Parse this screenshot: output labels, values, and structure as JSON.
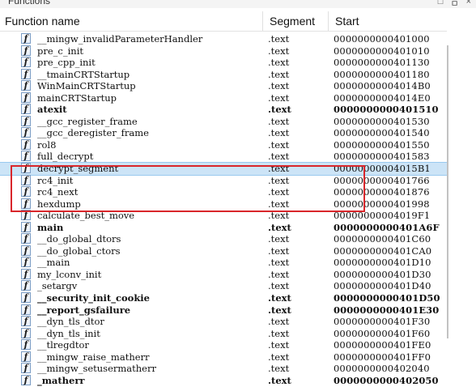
{
  "window": {
    "title": "Functions",
    "controls": [
      "□",
      "ㅁ",
      "×"
    ]
  },
  "columns": {
    "name": "Function name",
    "segment": "Segment",
    "start": "Start"
  },
  "functions": [
    {
      "name": "__mingw_invalidParameterHandler",
      "segment": ".text",
      "start": "0000000000401000",
      "bold": false
    },
    {
      "name": "pre_c_init",
      "segment": ".text",
      "start": "0000000000401010",
      "bold": false
    },
    {
      "name": "pre_cpp_init",
      "segment": ".text",
      "start": "0000000000401130",
      "bold": false
    },
    {
      "name": "__tmainCRTStartup",
      "segment": ".text",
      "start": "0000000000401180",
      "bold": false
    },
    {
      "name": "WinMainCRTStartup",
      "segment": ".text",
      "start": "00000000004014B0",
      "bold": false
    },
    {
      "name": "mainCRTStartup",
      "segment": ".text",
      "start": "00000000004014E0",
      "bold": false
    },
    {
      "name": "atexit",
      "segment": ".text",
      "start": "0000000000401510",
      "bold": true
    },
    {
      "name": "__gcc_register_frame",
      "segment": ".text",
      "start": "0000000000401530",
      "bold": false
    },
    {
      "name": "__gcc_deregister_frame",
      "segment": ".text",
      "start": "0000000000401540",
      "bold": false
    },
    {
      "name": "rol8",
      "segment": ".text",
      "start": "0000000000401550",
      "bold": false
    },
    {
      "name": "full_decrypt",
      "segment": ".text",
      "start": "0000000000401583",
      "bold": false
    },
    {
      "name": "decrypt_segment",
      "segment": ".text",
      "start": "00000000004015B1",
      "bold": false,
      "selected": true
    },
    {
      "name": "rc4_init",
      "segment": ".text",
      "start": "0000000000401766",
      "bold": false
    },
    {
      "name": "rc4_next",
      "segment": ".text",
      "start": "0000000000401876",
      "bold": false
    },
    {
      "name": "hexdump",
      "segment": ".text",
      "start": "0000000000401998",
      "bold": false
    },
    {
      "name": "calculate_best_move",
      "segment": ".text",
      "start": "00000000004019F1",
      "bold": false
    },
    {
      "name": "main",
      "segment": ".text",
      "start": "0000000000401A6F",
      "bold": true
    },
    {
      "name": "__do_global_dtors",
      "segment": ".text",
      "start": "0000000000401C60",
      "bold": false
    },
    {
      "name": "__do_global_ctors",
      "segment": ".text",
      "start": "0000000000401CA0",
      "bold": false
    },
    {
      "name": "__main",
      "segment": ".text",
      "start": "0000000000401D10",
      "bold": false
    },
    {
      "name": "my_lconv_init",
      "segment": ".text",
      "start": "0000000000401D30",
      "bold": false
    },
    {
      "name": "_setargv",
      "segment": ".text",
      "start": "0000000000401D40",
      "bold": false
    },
    {
      "name": "__security_init_cookie",
      "segment": ".text",
      "start": "0000000000401D50",
      "bold": true
    },
    {
      "name": "__report_gsfailure",
      "segment": ".text",
      "start": "0000000000401E30",
      "bold": true
    },
    {
      "name": "__dyn_tls_dtor",
      "segment": ".text",
      "start": "0000000000401F30",
      "bold": false
    },
    {
      "name": "__dyn_tls_init",
      "segment": ".text",
      "start": "0000000000401F60",
      "bold": false
    },
    {
      "name": "__tlregdtor",
      "segment": ".text",
      "start": "0000000000401FE0",
      "bold": false
    },
    {
      "name": "__mingw_raise_matherr",
      "segment": ".text",
      "start": "0000000000401FF0",
      "bold": false
    },
    {
      "name": "__mingw_setusermatherr",
      "segment": ".text",
      "start": "0000000000402040",
      "bold": false
    },
    {
      "name": "_matherr",
      "segment": ".text",
      "start": "0000000000402050",
      "bold": true
    }
  ],
  "icons": {
    "function_icon": "f",
    "function_icon_name": "function-icon"
  },
  "colors": {
    "selection": "#cce4f7",
    "highlight_box": "#d9262b"
  }
}
